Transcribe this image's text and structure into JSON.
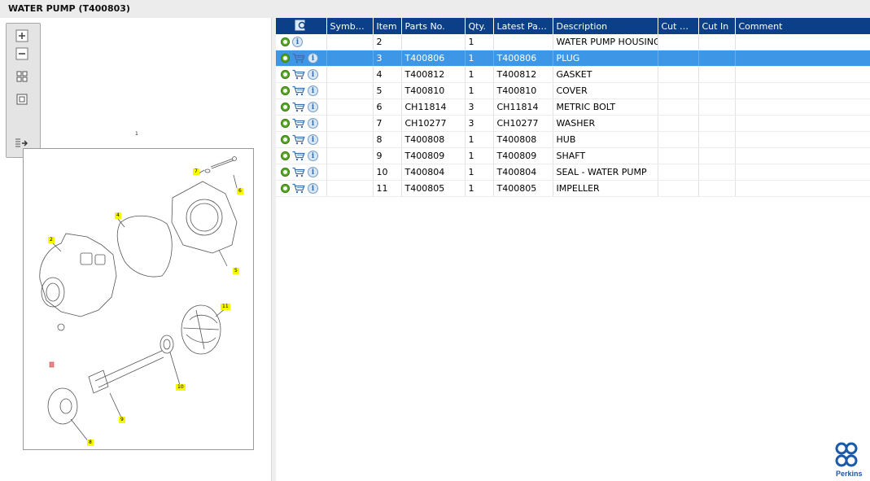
{
  "window": {
    "title": "WATER PUMP (T400803)"
  },
  "toolbar": {
    "buttons": [
      "zoom-in",
      "zoom-out",
      "fit-all",
      "fit-page",
      "export"
    ]
  },
  "diagram": {
    "assembly_label": "1",
    "callouts": [
      "2",
      "4",
      "5",
      "6",
      "7",
      "8",
      "9",
      "10",
      "11"
    ]
  },
  "table": {
    "columns": [
      "",
      "Symbol(s)",
      "Item",
      "Parts No.",
      "Qty.",
      "Latest Part...",
      "Description",
      "Cut Out",
      "Cut In",
      "Comment"
    ],
    "rows": [
      {
        "item": "2",
        "parts_no": "",
        "qty": "1",
        "latest_part": "",
        "description": "WATER PUMP HOUSING",
        "cart": false,
        "selected": false
      },
      {
        "item": "3",
        "parts_no": "T400806",
        "qty": "1",
        "latest_part": "T400806",
        "description": "PLUG",
        "cart": true,
        "selected": true
      },
      {
        "item": "4",
        "parts_no": "T400812",
        "qty": "1",
        "latest_part": "T400812",
        "description": "GASKET",
        "cart": true,
        "selected": false
      },
      {
        "item": "5",
        "parts_no": "T400810",
        "qty": "1",
        "latest_part": "T400810",
        "description": "COVER",
        "cart": true,
        "selected": false
      },
      {
        "item": "6",
        "parts_no": "CH11814",
        "qty": "3",
        "latest_part": "CH11814",
        "description": "METRIC BOLT",
        "cart": true,
        "selected": false
      },
      {
        "item": "7",
        "parts_no": "CH10277",
        "qty": "3",
        "latest_part": "CH10277",
        "description": "WASHER",
        "cart": true,
        "selected": false
      },
      {
        "item": "8",
        "parts_no": "T400808",
        "qty": "1",
        "latest_part": "T400808",
        "description": "HUB",
        "cart": true,
        "selected": false
      },
      {
        "item": "9",
        "parts_no": "T400809",
        "qty": "1",
        "latest_part": "T400809",
        "description": "SHAFT",
        "cart": true,
        "selected": false
      },
      {
        "item": "10",
        "parts_no": "T400804",
        "qty": "1",
        "latest_part": "T400804",
        "description": "SEAL - WATER PUMP",
        "cart": true,
        "selected": false
      },
      {
        "item": "11",
        "parts_no": "T400805",
        "qty": "1",
        "latest_part": "T400805",
        "description": "IMPELLER",
        "cart": true,
        "selected": false
      }
    ]
  },
  "brand": {
    "name": "Perkins",
    "color": "#1a5aa8"
  },
  "colors": {
    "header_bg": "#0b3f87",
    "selected_row": "#3d97e6",
    "callout": "#f7f700"
  }
}
